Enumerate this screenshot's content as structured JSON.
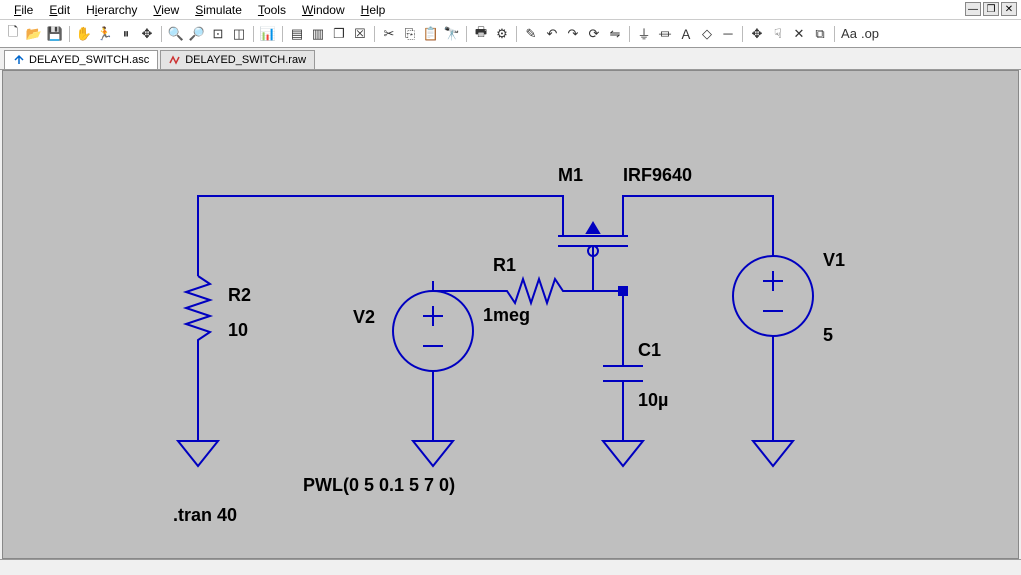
{
  "menus": {
    "file": "File",
    "edit": "Edit",
    "hierarchy": "Hierarchy",
    "view": "View",
    "simulate": "Simulate",
    "tools": "Tools",
    "window": "Window",
    "help": "Help"
  },
  "tabs": {
    "t1": "DELAYED_SWITCH.asc",
    "t2": "DELAYED_SWITCH.raw"
  },
  "components": {
    "m1": {
      "name": "M1",
      "model": "IRF9640"
    },
    "r1": {
      "name": "R1",
      "value": "1meg"
    },
    "r2": {
      "name": "R2",
      "value": "10"
    },
    "c1": {
      "name": "C1",
      "value": "10µ"
    },
    "v1": {
      "name": "V1",
      "value": "5"
    },
    "v2": {
      "name": "V2",
      "value": "PWL(0 5 0.1 5 7 0)"
    }
  },
  "directives": {
    "tran": ".tran 40"
  },
  "toolbar_icons": [
    "new",
    "open",
    "save",
    "sep",
    "hand",
    "run",
    "stop",
    "pan",
    "sep",
    "zoom-in",
    "zoom-out",
    "zoom-fit",
    "zoom-box",
    "sep",
    "autoscale",
    "sep",
    "tile-h",
    "tile-v",
    "cascade",
    "close-win",
    "sep",
    "cut",
    "copy",
    "paste",
    "find",
    "sep",
    "print",
    "setup",
    "sep",
    "pencil",
    "undo",
    "redo",
    "rotate",
    "mirror",
    "sep",
    "place-net",
    "place-gnd",
    "place-label",
    "place-comp",
    "place-wire",
    "sep",
    "move",
    "drag",
    "delete",
    "dup",
    "sep",
    "text",
    "spice"
  ],
  "icon_glyphs": {
    "new": "🗋",
    "open": "📂",
    "save": "💾",
    "hand": "✋",
    "run": "🏃",
    "stop": "⏸",
    "pan": "✥",
    "zoom-in": "🔍",
    "zoom-out": "🔎",
    "zoom-fit": "⊡",
    "zoom-box": "◫",
    "autoscale": "📊",
    "tile-h": "▤",
    "tile-v": "▥",
    "cascade": "❐",
    "close-win": "☒",
    "cut": "✂",
    "copy": "⎘",
    "paste": "📋",
    "find": "🔭",
    "print": "🖶",
    "setup": "⚙",
    "pencil": "✎",
    "undo": "↶",
    "redo": "↷",
    "rotate": "⟳",
    "mirror": "⇋",
    "place-net": "⏚",
    "place-gnd": "⏛",
    "place-label": "Ａ",
    "place-comp": "◇",
    "place-wire": "─",
    "move": "✥",
    "drag": "☟",
    "delete": "✕",
    "dup": "⧉",
    "text": "Aa",
    "spice": ".op"
  }
}
